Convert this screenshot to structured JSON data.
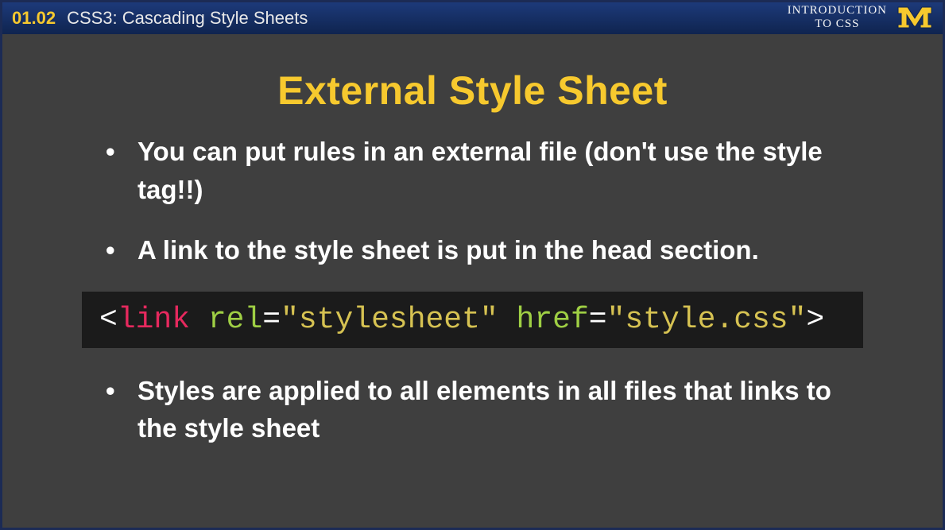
{
  "header": {
    "chapter": "01.02",
    "lecture": "CSS3: Cascading Style Sheets",
    "course_line1": "INTRODUCTION",
    "course_line2": "TO CSS"
  },
  "slide": {
    "title": "External Style Sheet",
    "bullets": [
      "You can put rules in an external file (don't use the style tag!!)",
      "A link to the style sheet is put in the head section.",
      "Styles are applied to all elements in all files that links to the style sheet"
    ],
    "code": {
      "open": "<",
      "tag": "link",
      "attr1": "rel",
      "val1": "\"stylesheet\"",
      "attr2": "href",
      "val2": "\"style.css\"",
      "eq": "=",
      "close": ">"
    }
  }
}
